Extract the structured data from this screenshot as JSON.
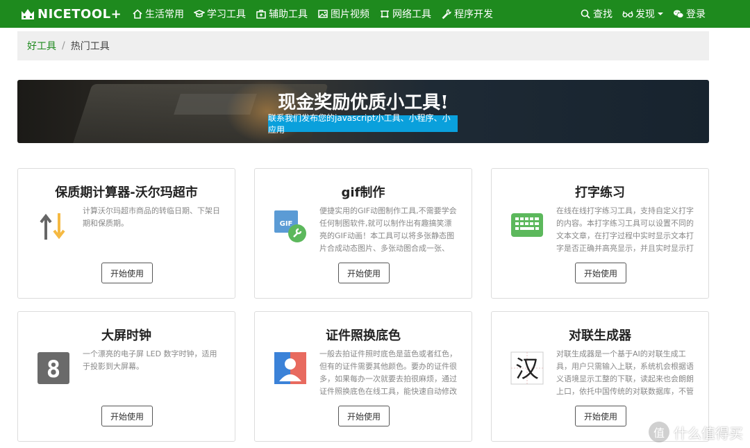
{
  "navbar": {
    "logo": "NICETOOL+",
    "items": [
      {
        "label": "生活常用",
        "icon": "home-icon"
      },
      {
        "label": "学习工具",
        "icon": "graduation-cap-icon"
      },
      {
        "label": "辅助工具",
        "icon": "medkit-icon"
      },
      {
        "label": "图片视频",
        "icon": "image-icon"
      },
      {
        "label": "网络工具",
        "icon": "network-icon"
      },
      {
        "label": "程序开发",
        "icon": "wrench-icon"
      }
    ],
    "right": {
      "search": "查找",
      "discover": "发现",
      "login": "登录"
    }
  },
  "breadcrumb": {
    "home": "好工具",
    "separator": "/",
    "current": "热门工具"
  },
  "banner": {
    "title": "现金奖励优质小工具!",
    "subtitle": "联系我们发布您的javascript小工具、小程序、小应用"
  },
  "cards": [
    {
      "title": "保质期计算器-沃尔玛超市",
      "desc": "计算沃尔玛超市商品的转临日期、下架日期和保质期。",
      "button": "开始使用",
      "icon": "sort-arrows-icon"
    },
    {
      "title": "gif制作",
      "desc": "便捷实用的GIF动图制作工具,不需要学会任何制图软件,就可以制作出有趣搞笑漂亮的GIF动画！本工具可以将多张静态图片合成动态图片、多张动图合成一张、gif图",
      "button": "开始使用",
      "icon": "gif-maker-icon"
    },
    {
      "title": "打字练习",
      "desc": "在线在线打字练习工具，支持自定义打字的内容。本打字练习工具可以设置不同的文本文章，在打字过程中实时显示文本打字是否正确并高亮显示，并且实时显示打",
      "button": "开始使用",
      "icon": "keyboard-icon"
    },
    {
      "title": "大屏时钟",
      "desc": "一个漂亮的电子屏 LED 数字时钟，适用于投影到大屏幕。",
      "button": "开始使用",
      "icon": "led-digit-icon"
    },
    {
      "title": "证件照换底色",
      "desc": "一般去拍证件照时底色是蓝色或者红色，但有的证件需要其他颜色。要办的证件很多，如果每办一次就要去拍很麻烦，通过证件照换底色在线工具，能快速自动修改",
      "button": "开始使用",
      "icon": "id-photo-icon"
    },
    {
      "title": "对联生成器",
      "desc": "对联生成器是一个基于AI的对联生成工具，用户只需输入上联，系统机会根据语义语境显示工整的下联，读起来也会朗朗上口，依托中国传统的对联数据库，不管",
      "button": "开始使用",
      "icon": "chinese-character-icon"
    }
  ],
  "icon_glyphs": {
    "digit": "8",
    "han": "汉",
    "gif": "GIF"
  },
  "watermark": {
    "badge": "值",
    "text": "什么值得买"
  },
  "colors": {
    "nav_green": "#1e8a1e",
    "banner_tag_blue": "#0aa0dc"
  }
}
